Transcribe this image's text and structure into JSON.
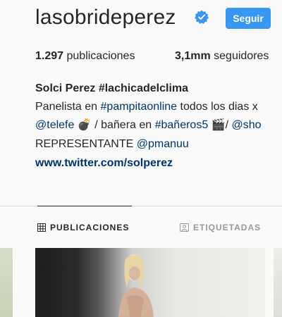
{
  "profile": {
    "username": "lasobrideperez",
    "follow_label": "Seguir",
    "verified_icon": "verified-badge-icon"
  },
  "stats": {
    "posts_count": "1.297",
    "posts_label": "publicaciones",
    "followers_count": "3,1mm",
    "followers_label": "seguidores"
  },
  "bio": {
    "name": "Solci Perez #lachicadelclima",
    "line1_prefix": "Panelista en ",
    "line1_tag": "#pampitaonline",
    "line1_suffix": " todos los dias x",
    "line2_tag1": "@telefe",
    "line2_emoji1": "💣",
    "line2_mid": " / bañera en ",
    "line2_tag2": "#bañeros5",
    "line2_emoji2": "🎬",
    "line2_end": "/ ",
    "line2_tag3": "@sho",
    "line3_prefix": "REPRESENTANTE ",
    "line3_tag": "@pmanuu",
    "link": "www.twitter.com/solperez"
  },
  "tabs": {
    "posts": "PUBLICACIONES",
    "tagged": "ETIQUETADAS"
  },
  "colors": {
    "follow_button": "#3897f0",
    "verified_badge": "#3897f0",
    "hashtag": "#003569"
  }
}
